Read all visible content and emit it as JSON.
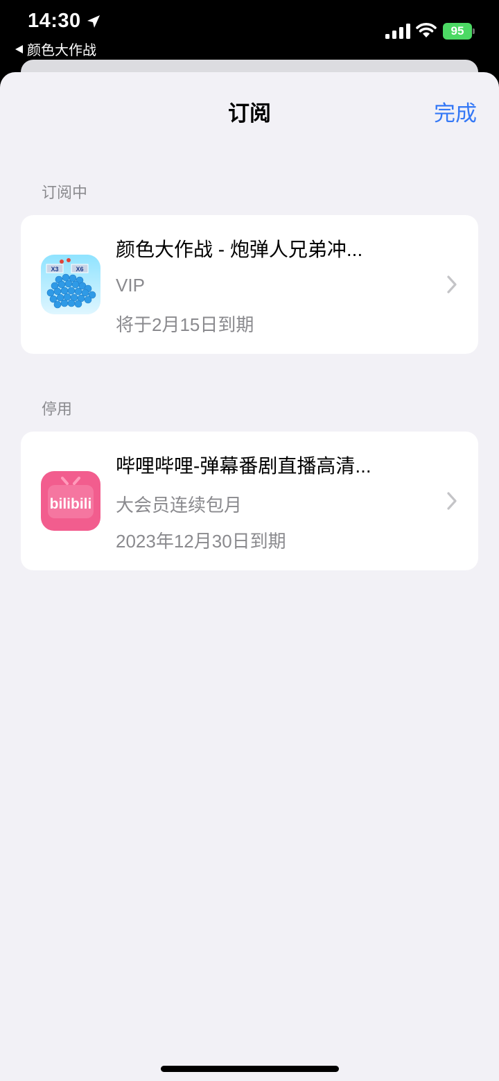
{
  "status_bar": {
    "time": "14:30",
    "back_app": "颜色大作战",
    "battery": "95"
  },
  "nav": {
    "title": "订阅",
    "done": "完成"
  },
  "sections": {
    "active_header": "订阅中",
    "inactive_header": "停用"
  },
  "subscriptions": [
    {
      "title": "颜色大作战 - 炮弹人兄弟冲...",
      "plan": "VIP",
      "expiry": "将于2月15日到期",
      "icon_label": "X3 X6"
    },
    {
      "title": "哔哩哔哩-弹幕番剧直播高清...",
      "plan": "大会员连续包月",
      "expiry": "2023年12月30日到期",
      "icon_label": "bilibili"
    }
  ],
  "colors": {
    "accent": "#3478f6",
    "battery": "#4cd964",
    "bilibili_pink": "#f25d8e",
    "secondary_text": "#8a8a8e"
  }
}
